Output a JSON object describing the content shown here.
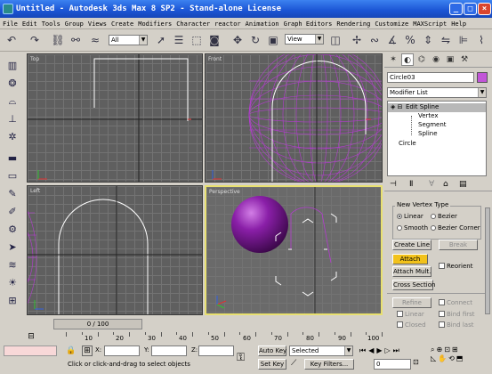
{
  "window": {
    "title": "Untitled - Autodesk 3ds Max 8 SP2 - Stand-alone License",
    "minimize": "_",
    "maximize": "□",
    "close": "×"
  },
  "menu": [
    "File",
    "Edit",
    "Tools",
    "Group",
    "Views",
    "Create",
    "Modifiers",
    "Character",
    "reactor",
    "Animation",
    "Graph Editors",
    "Rendering",
    "Customize",
    "MAXScript",
    "Help"
  ],
  "toolbar": {
    "selection_filter": "All",
    "coord_system": "View"
  },
  "viewports": {
    "top": "Top",
    "front": "Front",
    "left": "Left",
    "perspective": "Perspective"
  },
  "command_panel": {
    "object_name": "Circle03",
    "object_color": "#c255d8",
    "modifier_list": "Modifier List",
    "stack": {
      "edit_spline": "Edit Spline",
      "vertex": "Vertex",
      "segment": "Segment",
      "spline": "Spline",
      "circle": "Circle"
    },
    "new_vertex_type": {
      "title": "New Vertex Type",
      "linear": "Linear",
      "bezier": "Bezier",
      "smooth": "Smooth",
      "bezier_corner": "Bezier Corner"
    },
    "buttons": {
      "create_line": "Create Line",
      "break": "Break",
      "attach": "Attach",
      "reorient": "Reorient",
      "attach_mult": "Attach Mult.",
      "cross_section": "Cross Section",
      "refine": "Refine",
      "connect": "Connect",
      "linear": "Linear",
      "bind_first": "Bind first",
      "closed": "Closed",
      "bind_last": "Bind last"
    },
    "attach_color": "#f2c21b"
  },
  "timeline": {
    "slider": "0 / 100",
    "ticks": [
      "10",
      "20",
      "30",
      "40",
      "50",
      "60",
      "70",
      "80",
      "90",
      "100"
    ]
  },
  "status": {
    "prompt": "Click or click-and-drag to select objects",
    "x_label": "X:",
    "y_label": "Y:",
    "z_label": "Z:",
    "auto_key": "Auto Key",
    "set_key": "Set Key",
    "selected": "Selected",
    "key_filters": "Key Filters...",
    "frame": "0"
  },
  "colors": {
    "viewport_bg": "#5f5f5f",
    "active_viewport_border": "#e8e070",
    "title_blue": "#1b54d4",
    "spline_white": "#ffffff",
    "sphere_purple": "#8a1fa8"
  }
}
